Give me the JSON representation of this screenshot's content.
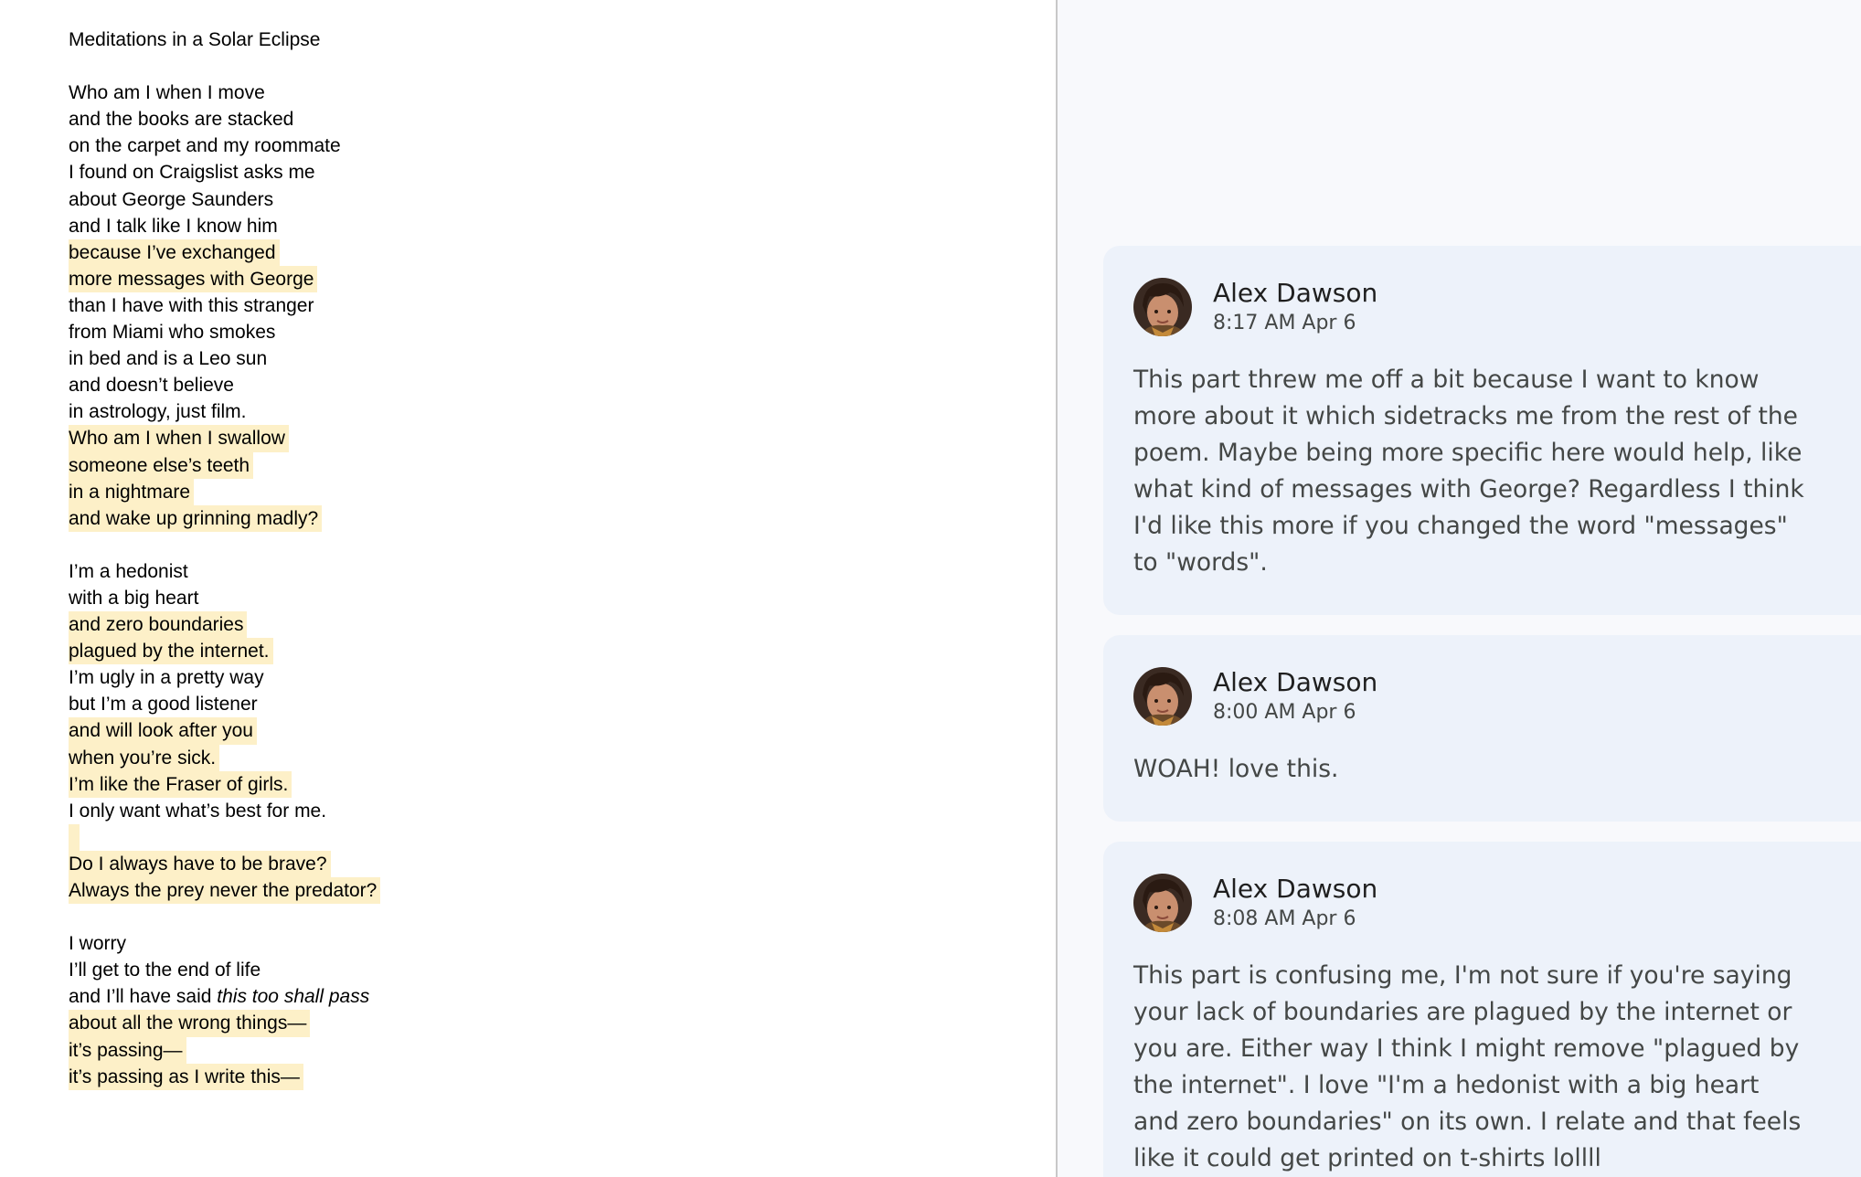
{
  "document": {
    "title": "Meditations in a Solar Eclipse",
    "lines": [
      {
        "text": "Who am I when I move",
        "highlighted": false
      },
      {
        "text": "and the books are stacked",
        "highlighted": false
      },
      {
        "text": "on the carpet and my roommate",
        "highlighted": false
      },
      {
        "text": "I found on Craigslist asks me",
        "highlighted": false
      },
      {
        "text": "about George Saunders",
        "highlighted": false
      },
      {
        "text": "and I talk like I know him",
        "highlighted": false
      },
      {
        "text": "because I’ve exchanged",
        "highlighted": true
      },
      {
        "text": "more messages with George",
        "highlighted": true
      },
      {
        "text": "than I have with this stranger",
        "highlighted": false
      },
      {
        "text": "from Miami who smokes",
        "highlighted": false
      },
      {
        "text": "in bed and is a Leo sun",
        "highlighted": false
      },
      {
        "text": "and doesn’t believe",
        "highlighted": false
      },
      {
        "text": "in astrology, just film.",
        "highlighted": false
      },
      {
        "text": "Who am I when I swallow",
        "highlighted": true
      },
      {
        "text": "someone else’s teeth",
        "highlighted": true
      },
      {
        "text": "in a nightmare",
        "highlighted": true
      },
      {
        "text": "and wake up grinning madly?",
        "highlighted": true
      },
      {
        "text": "",
        "highlighted": false
      },
      {
        "text": "I’m a hedonist",
        "highlighted": false
      },
      {
        "text": "with a big heart",
        "highlighted": false
      },
      {
        "text": "and zero boundaries",
        "highlighted": true
      },
      {
        "text": "plagued by the internet.",
        "highlighted": true
      },
      {
        "text": "I’m ugly in a pretty way",
        "highlighted": false
      },
      {
        "text": "but I’m a good listener",
        "highlighted": false
      },
      {
        "text": "and will look after you",
        "highlighted": true
      },
      {
        "text": "when you’re sick.",
        "highlighted": true
      },
      {
        "text": "I’m like the Fraser of girls.",
        "highlighted": true
      },
      {
        "text": "I only want what’s best for me.",
        "highlighted": false
      },
      {
        "text": "",
        "highlighted": true
      },
      {
        "text": "Do I always have to be brave?",
        "highlighted": true
      },
      {
        "text": "Always the prey never the predator?",
        "highlighted": true
      },
      {
        "text": "",
        "highlighted": false
      },
      {
        "text": "I worry",
        "highlighted": false
      },
      {
        "text": "I’ll get to the end of life",
        "highlighted": false
      },
      {
        "text": "and I’ll have said ",
        "italic_suffix": "this too shall pass",
        "highlighted": false
      },
      {
        "text": "about all the wrong things—",
        "highlighted": true
      },
      {
        "text": "it’s passing—",
        "highlighted": true
      },
      {
        "text": "it’s passing as I write this—",
        "highlighted": true
      }
    ]
  },
  "comments": [
    {
      "author": "Alex Dawson",
      "time": "8:17 AM Apr 6",
      "text": "This part threw me off a bit because I want to know more about it which sidetracks me from the rest of the poem. Maybe being more specific here would help, like what kind of messages with George? Regardless I think I'd like this more if you changed the word \"messages\" to \"words\"."
    },
    {
      "author": "Alex Dawson",
      "time": "8:00 AM Apr 6",
      "text": "WOAH! love this."
    },
    {
      "author": "Alex Dawson",
      "time": "8:08 AM Apr 6",
      "text": "This part is confusing me, I'm not sure if you're saying your lack of boundaries are plagued by the internet or you are. Either way I think I might remove \"plagued by the internet\". I love \"I'm a hedonist with a big heart and zero boundaries\" on its own. I relate and that feels like it could get printed on t-shirts lollll"
    }
  ],
  "colors": {
    "highlight": "#fdf0c8",
    "comment_card": "#edf2fa",
    "sidebar_bg": "#f8f9fc"
  }
}
